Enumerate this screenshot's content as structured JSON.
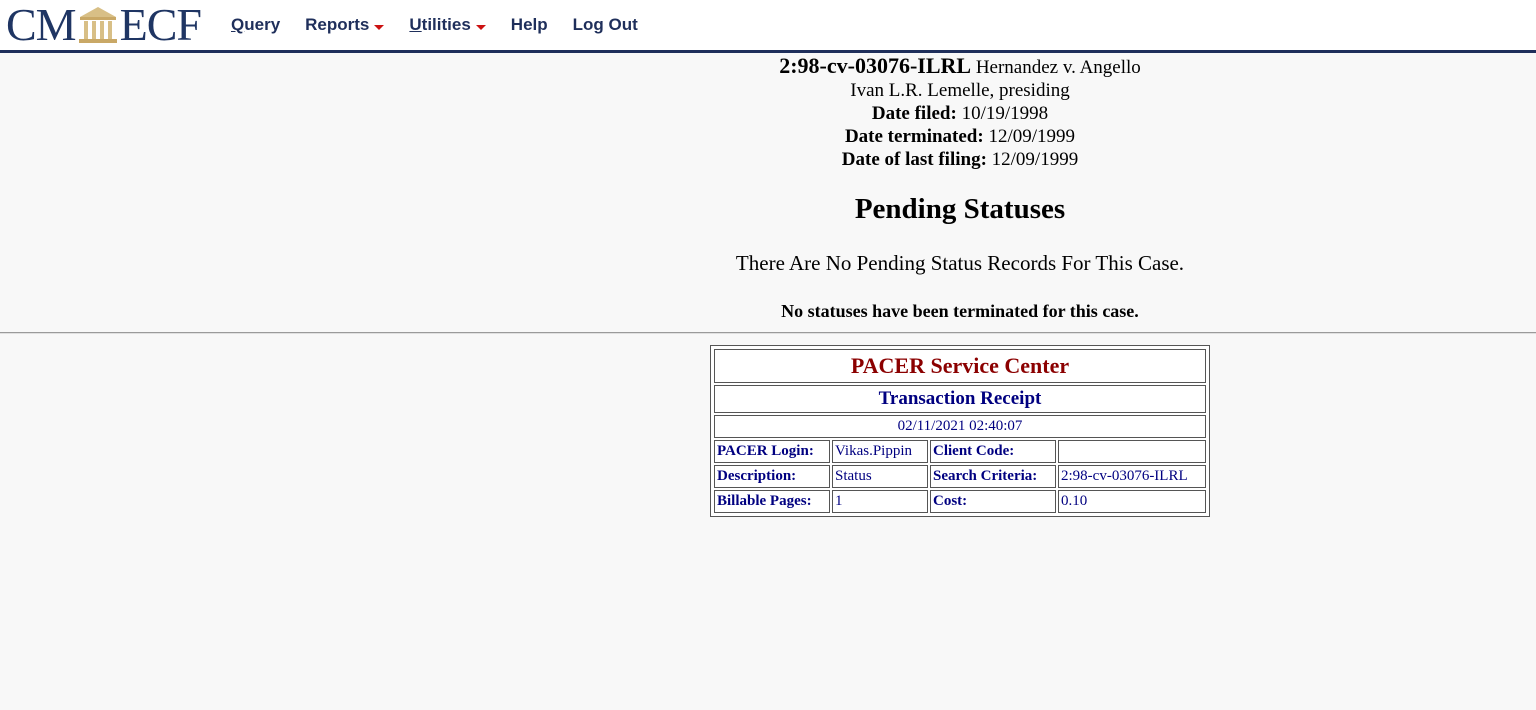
{
  "nav": {
    "logo_left": "CM",
    "logo_right": "ECF",
    "items": [
      {
        "label": "Query",
        "underline": "Q",
        "rest": "uery"
      },
      {
        "label": "Reports"
      },
      {
        "label": "Utilities",
        "underline": "U",
        "rest": "tilities"
      },
      {
        "label": "Help"
      },
      {
        "label": "Log Out"
      }
    ],
    "accent_color": "#1f2f5b",
    "caret_color": "#cc1111"
  },
  "case": {
    "number": "2:98-cv-03076-ILRL",
    "title": "Hernandez v. Angello",
    "presiding": "Ivan L.R. Lemelle, presiding",
    "date_filed_label": "Date filed:",
    "date_filed": "10/19/1998",
    "date_terminated_label": "Date terminated:",
    "date_terminated": "12/09/1999",
    "date_last_filing_label": "Date of last filing:",
    "date_last_filing": "12/09/1999"
  },
  "main": {
    "heading": "Pending Statuses",
    "no_pending": "There Are No Pending Status Records For This Case.",
    "no_terminated": "No statuses have been terminated for this case."
  },
  "receipt": {
    "title": "PACER Service Center",
    "subtitle": "Transaction Receipt",
    "timestamp": "02/11/2021 02:40:07",
    "rows": [
      {
        "label1": "PACER Login:",
        "value1": "Vikas.Pippin",
        "label2": "Client Code:",
        "value2": ""
      },
      {
        "label1": "Description:",
        "value1": "Status",
        "label2": "Search Criteria:",
        "value2": "2:98-cv-03076-ILRL"
      },
      {
        "label1": "Billable Pages:",
        "value1": "1",
        "label2": "Cost:",
        "value2": "0.10"
      }
    ],
    "title_color": "#8b0000",
    "text_color": "#000080"
  }
}
